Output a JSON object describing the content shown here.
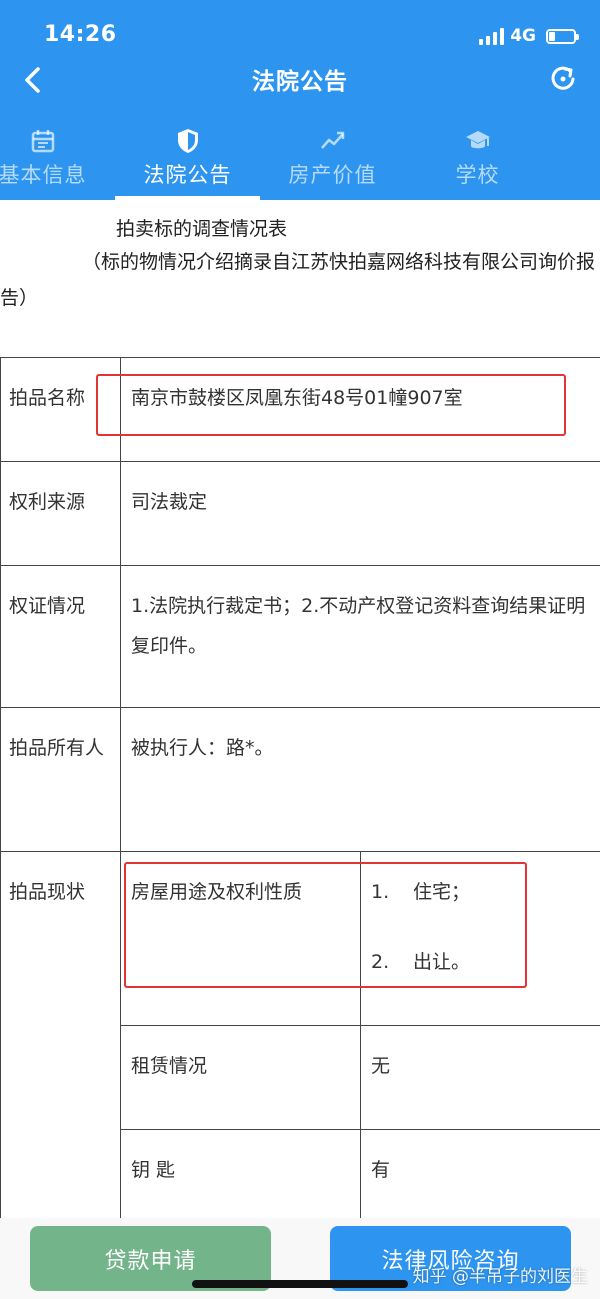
{
  "status": {
    "time": "14:26",
    "network": "4G",
    "battery_level": 0.25
  },
  "nav": {
    "title": "法院公告",
    "back_icon": "chevron-left-icon",
    "refresh_icon": "refresh-icon"
  },
  "tabs": [
    {
      "label": "基本信息",
      "icon": "calendar-icon",
      "active": false
    },
    {
      "label": "法院公告",
      "icon": "shield-icon",
      "active": true
    },
    {
      "label": "房产价值",
      "icon": "trend-up-icon",
      "active": false
    },
    {
      "label": "学校",
      "icon": "graduation-cap-icon",
      "active": false
    }
  ],
  "document": {
    "title": "拍卖标的调查情况表",
    "note": "（标的物情况介绍摘录自江苏快拍嘉网络科技有限公司询价报告）",
    "rows": {
      "item_name": {
        "label": "拍品名称",
        "value": "南京市鼓楼区凤凰东街48号01幢907室"
      },
      "rights_source": {
        "label": "权利来源",
        "value": "司法裁定"
      },
      "certificate": {
        "label": "权证情况",
        "value": "1.法院执行裁定书；2.不动产权登记资料查询结果证明复印件。"
      },
      "owner": {
        "label": "拍品所有人",
        "value": "被执行人：路*。"
      },
      "status": {
        "label": "拍品现状",
        "usage_label": "房屋用途及权利性质",
        "usage_items": [
          {
            "num": "1.",
            "text": "住宅；"
          },
          {
            "num": "2.",
            "text": "出让。"
          }
        ],
        "lease_label": "租赁情况",
        "lease_value": "无",
        "key_label": "钥 匙",
        "key_value": "有"
      }
    }
  },
  "bottom": {
    "loan_label": "贷款申请",
    "legal_label": "法律风险咨询",
    "watermark": "知乎 @半吊子的刘医生"
  },
  "colors": {
    "header_blue": "#2d95f0",
    "loan_green": "#74b48a",
    "highlight_red": "#e23434"
  }
}
